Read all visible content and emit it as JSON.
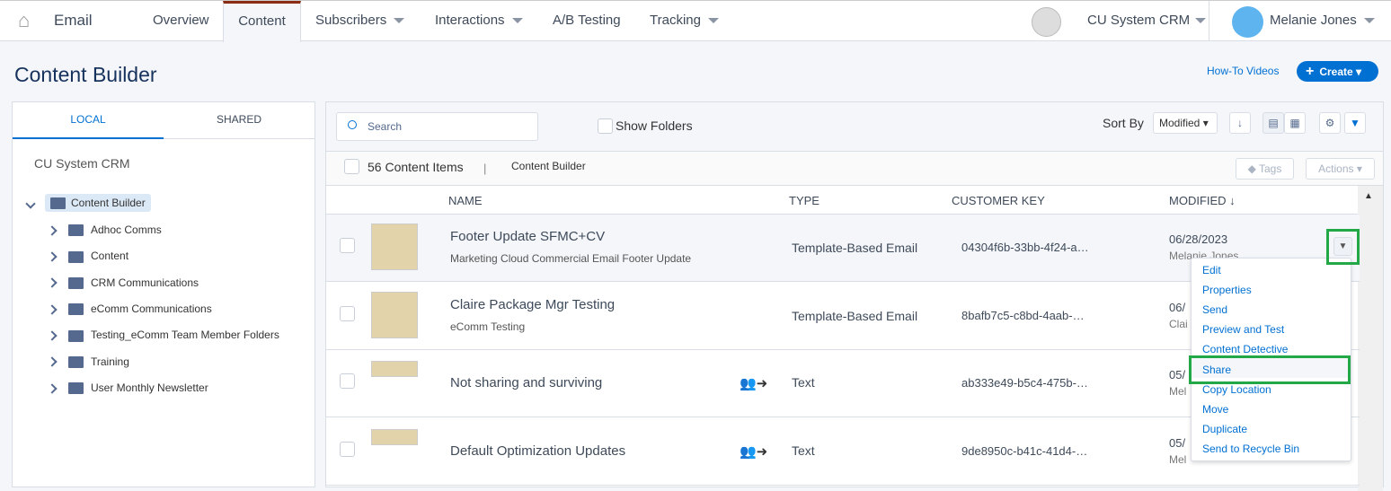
{
  "nav": {
    "app": "Email",
    "tabs": [
      "Overview",
      "Content",
      "Subscribers",
      "Interactions",
      "A/B Testing",
      "Tracking"
    ],
    "account": "CU System CRM",
    "user": "Melanie Jones"
  },
  "page": {
    "title": "Content Builder",
    "howto": "How-To Videos",
    "create": "Create"
  },
  "left": {
    "tabs": [
      "LOCAL",
      "SHARED"
    ],
    "org": "CU System CRM",
    "root": "Content Builder",
    "folders": [
      "Adhoc Comms",
      "Content",
      "CRM Communications",
      "eComm Communications",
      "Testing_eComm Team Member Folders",
      "Training",
      "User Monthly Newsletter"
    ]
  },
  "toolbar": {
    "search_placeholder": "Search",
    "show_folders": "Show Folders",
    "sort_by": "Sort By",
    "sort_value": "Modified",
    "count": "56 Content Items",
    "separator": "|",
    "breadcrumb": "Content Builder",
    "tags": "Tags",
    "actions": "Actions"
  },
  "columns": [
    "NAME",
    "TYPE",
    "CUSTOMER KEY",
    "MODIFIED ↓"
  ],
  "rows": [
    {
      "name": "Footer Update SFMC+CV",
      "desc": "Marketing Cloud Commercial Email Footer Update",
      "type": "Template-Based Email",
      "key": "04304f6b-33bb-4f24-a…",
      "modified": "06/28/2023",
      "by": "Melanie Jones"
    },
    {
      "name": "Claire Package Mgr Testing",
      "desc": "eComm Testing",
      "type": "Template-Based Email",
      "key": "8bafb7c5-c8bd-4aab-…",
      "modified": "06/",
      "by": "Clai"
    },
    {
      "name": "Not sharing and surviving",
      "desc": "",
      "type": "Text",
      "key": "ab333e49-b5c4-475b-…",
      "modified": "05/",
      "by": "Mel",
      "shared": true
    },
    {
      "name": "Default Optimization Updates",
      "desc": "",
      "type": "Text",
      "key": "9de8950c-b41c-41d4-…",
      "modified": "05/",
      "by": "Mel",
      "shared": true
    }
  ],
  "menu": [
    "Edit",
    "Properties",
    "Send",
    "Preview and Test",
    "Content Detective",
    "Share",
    "Copy Location",
    "Move",
    "Duplicate",
    "Send to Recycle Bin"
  ],
  "colors": {
    "accent": "#0070d2",
    "highlight": "#22a846"
  }
}
